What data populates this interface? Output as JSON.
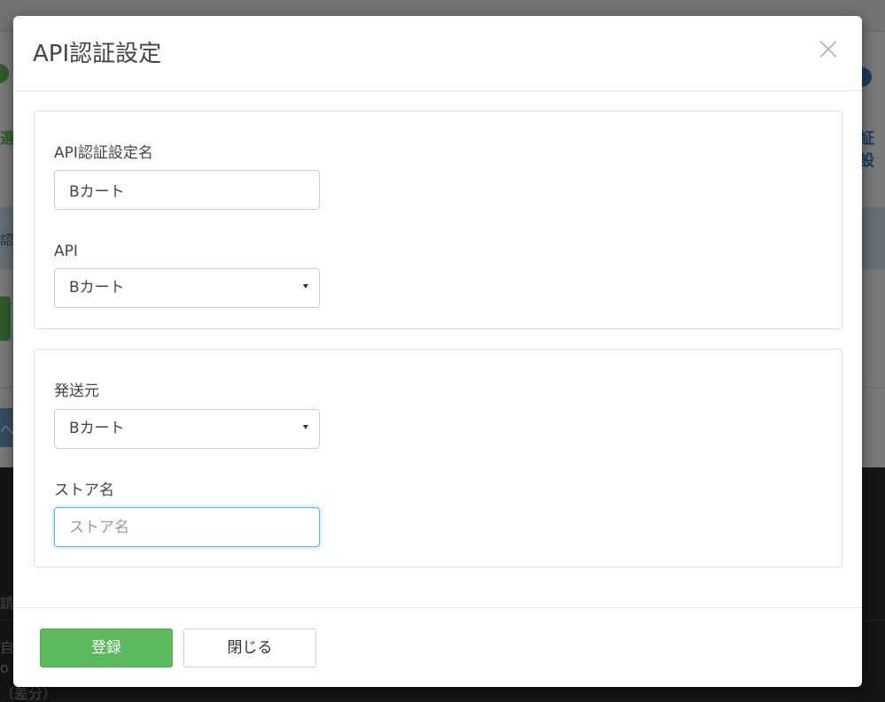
{
  "background": {
    "step_left_label": "選",
    "step_right_label": "証設",
    "info_band_text": "認証",
    "blue_btn_glyph": "へ",
    "dark_line_1": "請I",
    "dark_line_2": "自動",
    "dark_line_3": "o",
    "dark_line_4": "（差分）"
  },
  "modal": {
    "title": "API認証設定",
    "panel1": {
      "name_label": "API認証設定名",
      "name_value": "Bカート",
      "api_label": "API",
      "api_selected": "Bカート"
    },
    "panel2": {
      "sender_label": "発送元",
      "sender_selected": "Bカート",
      "store_label": "ストア名",
      "store_placeholder": "ストア名",
      "store_value": ""
    },
    "footer": {
      "submit_label": "登録",
      "close_label": "閉じる"
    }
  },
  "colors": {
    "primary_green": "#5cb85c",
    "focus_blue": "#66afe9",
    "step_blue": "#337ab7"
  }
}
